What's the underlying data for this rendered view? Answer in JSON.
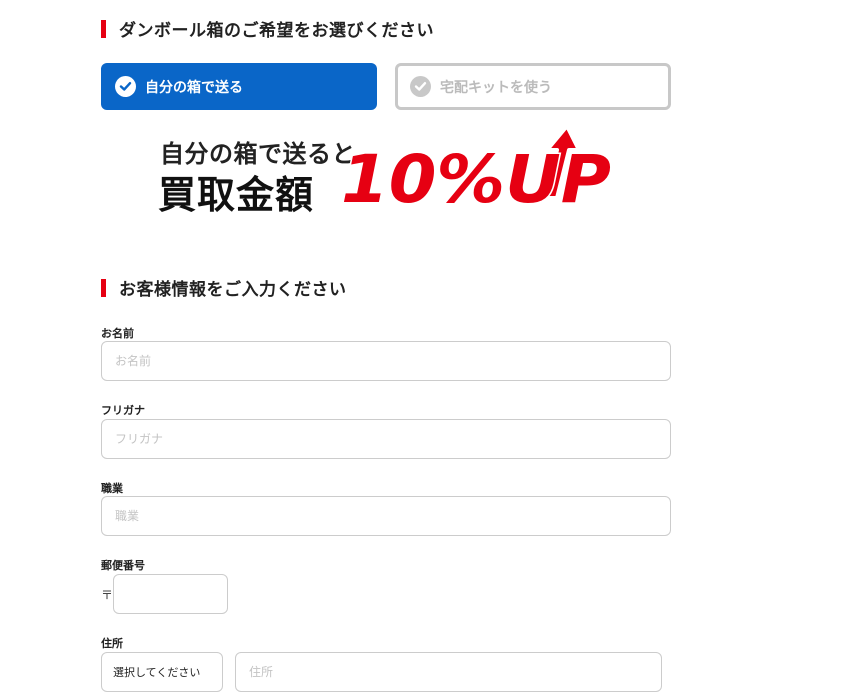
{
  "box_section": {
    "title": "ダンボール箱のご希望をお選びください",
    "option_own_box": "自分の箱で送る",
    "option_kit": "宅配キットを使う"
  },
  "promo": {
    "line1": "自分の箱で送ると",
    "line2": "買取金額",
    "highlight": "10%UP"
  },
  "info_section": {
    "title": "お客様情報をご入力ください"
  },
  "form": {
    "name_label": "お名前",
    "name_placeholder": "お名前",
    "kana_label": "フリガナ",
    "kana_placeholder": "フリガナ",
    "job_label": "職業",
    "job_placeholder": "職業",
    "zip_label": "郵便番号",
    "zip_mark": "〒",
    "address_label": "住所",
    "prefecture_select": "選択してください",
    "address_placeholder": "住所"
  },
  "colors": {
    "accent_red": "#e60012",
    "selected_blue": "#0a66c8",
    "disabled_gray": "#c8c8c8"
  }
}
